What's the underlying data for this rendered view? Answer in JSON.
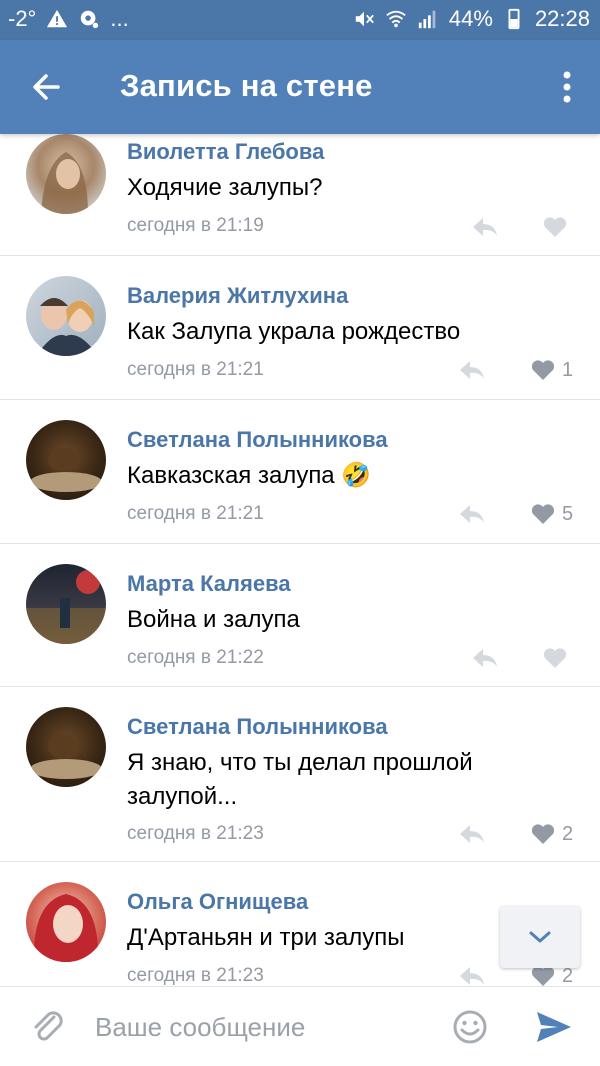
{
  "status_bar": {
    "temperature": "-2°",
    "ellipsis": "...",
    "battery": "44%",
    "time": "22:28"
  },
  "appbar": {
    "title": "Запись на стене"
  },
  "comments": [
    {
      "author": "Виолетта Глебова",
      "text": "Ходячие залупы?",
      "time": "сегодня в 21:19",
      "likes": ""
    },
    {
      "author": "Валерия Житлухина",
      "text": "Как Залупа украла рождество",
      "time": "сегодня в 21:21",
      "likes": "1"
    },
    {
      "author": "Светлана Полынникова",
      "text": "Кавказская залупа 🤣",
      "time": "сегодня в 21:21",
      "likes": "5"
    },
    {
      "author": "Марта Каляева",
      "text": "Война и залупа",
      "time": "сегодня в 21:22",
      "likes": ""
    },
    {
      "author": "Светлана Полынникова",
      "text": "Я знаю, что ты делал прошлой залупой...",
      "time": "сегодня в 21:23",
      "likes": "2"
    },
    {
      "author": "Ольга Огнищева",
      "text": "Д'Артаньян и три залупы",
      "time": "сегодня в 21:23",
      "likes": "2"
    }
  ],
  "composer": {
    "placeholder": "Ваше сообщение"
  },
  "colors": {
    "header": "#5181b8",
    "statusbar": "#4a76a8",
    "author": "#4a76a8",
    "meta": "#939aa3"
  }
}
